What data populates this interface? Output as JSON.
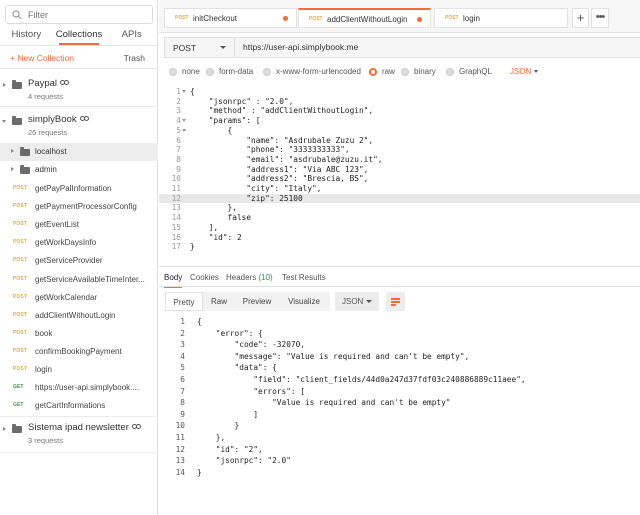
{
  "sidebar": {
    "filter_placeholder": "Filter",
    "tabs": [
      "History",
      "Collections",
      "APIs"
    ],
    "new_collection": "+ New Collection",
    "trash": "Trash",
    "collections": [
      {
        "name": "Paypal",
        "meta": "4 requests"
      },
      {
        "name": "simplyBook",
        "meta": "26 requests"
      },
      {
        "name": "Sistema ipad newsletter",
        "meta": "3 requests"
      }
    ],
    "folders": [
      "localhost",
      "admin"
    ],
    "requests": [
      {
        "method": "POST",
        "name": "getPayPalInformation"
      },
      {
        "method": "POST",
        "name": "getPaymentProcessorConfig"
      },
      {
        "method": "POST",
        "name": "getEventList"
      },
      {
        "method": "POST",
        "name": "getWorkDaysInfo"
      },
      {
        "method": "POST",
        "name": "getServiceProvider"
      },
      {
        "method": "POST",
        "name": "getServiceAvailableTimeInter..."
      },
      {
        "method": "POST",
        "name": "getWorkCalendar"
      },
      {
        "method": "POST",
        "name": "addClientWithoutLogin"
      },
      {
        "method": "POST",
        "name": "book"
      },
      {
        "method": "POST",
        "name": "confirmBookingPayment"
      },
      {
        "method": "POST",
        "name": "login"
      },
      {
        "method": "GET",
        "name": "https://user-api.simplybook...."
      },
      {
        "method": "GET",
        "name": "getCartInformations"
      }
    ]
  },
  "tabs": [
    {
      "method": "POST",
      "name": "initCheckout"
    },
    {
      "method": "POST",
      "name": "addClientWithoutLogin"
    },
    {
      "method": "POST",
      "name": "login"
    }
  ],
  "tab_add": "+",
  "tab_more": "•••",
  "request": {
    "method": "POST",
    "url": "https://user-api.simplybook.me"
  },
  "body_types": [
    "none",
    "form-data",
    "x-www-form-urlencoded",
    "raw",
    "binary",
    "GraphQL"
  ],
  "body_format": "JSON",
  "request_body": [
    "{",
    "    \"jsonrpc\" : \"2.0\",",
    "    \"method\" : \"addClientWithoutLogin\",",
    "    \"params\": [",
    "        {",
    "            \"name\": \"Asdrubale Zuzu 2\",",
    "            \"phone\": \"3333333333\",",
    "            \"email\": \"asdrubale@zuzu.it\",",
    "            \"address1\": \"Via ABC 123\",",
    "            \"address2\": \"Brescia, BS\",",
    "            \"city\": \"Italy\",",
    "            \"zip\": 25100",
    "        },",
    "        false",
    "    ],",
    "    \"id\": 2",
    "}"
  ],
  "response_tabs": [
    {
      "label": "Body"
    },
    {
      "label": "Cookies"
    },
    {
      "label": "Headers",
      "count": "(10)"
    },
    {
      "label": "Test Results"
    }
  ],
  "view_modes": [
    "Pretty",
    "Raw",
    "Preview",
    "Visualize"
  ],
  "response_format": "JSON",
  "response_body": [
    "{",
    "    \"error\": {",
    "        \"code\": -32070,",
    "        \"message\": \"Value is required and can't be empty\",",
    "        \"data\": {",
    "            \"field\": \"client_fields/44d0a247d37fdf03c240886889c11aee\",",
    "            \"errors\": [",
    "                \"Value is required and can't be empty\"",
    "            ]",
    "        }",
    "    },",
    "    \"id\": \"2\",",
    "    \"jsonrpc\": \"2.0\"",
    "}"
  ],
  "colors": {
    "accent": "#f26b3a",
    "post": "#f0a640",
    "get": "#2e9e4a"
  }
}
